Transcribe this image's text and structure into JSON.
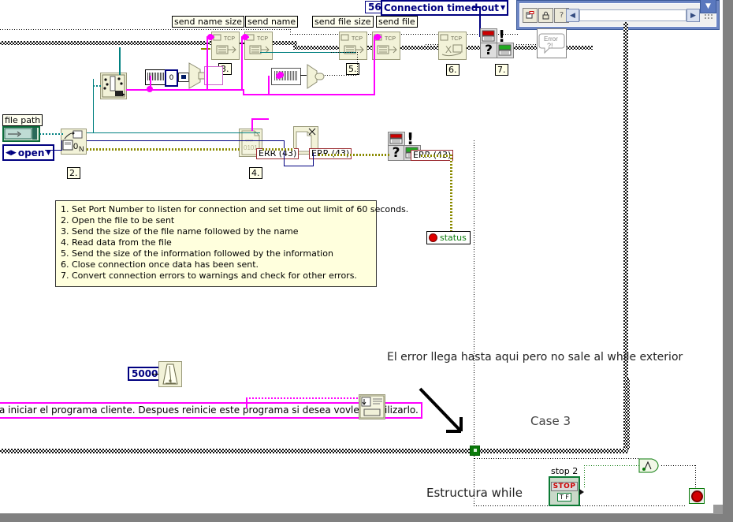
{
  "window": {
    "toolbar_buttons": [
      "diagram-icon",
      "lock-icon",
      "help-icon"
    ],
    "scroll_left": "◀",
    "scroll_right": "▶",
    "scroll_down": "▼"
  },
  "constants": {
    "timeout_value": "56",
    "timeout_enum": "Connection timed out",
    "wait_ms": "5000",
    "open_enum": "open"
  },
  "controls": {
    "file_path_label": "file path",
    "stop_label": "stop 2",
    "stop_button_text": "STOP",
    "stop_tf": "T F",
    "status_label": "status"
  },
  "node_labels": {
    "send_name_size": "send name size",
    "send_name": "send name",
    "send_file_size": "send file size",
    "send_file": "send file"
  },
  "step_markers": {
    "s2": "2.",
    "s3": "3.",
    "s4": "4.",
    "s5": "5.",
    "s6": "6.",
    "s7": "7."
  },
  "error_tags": {
    "e1": "ERR (43)",
    "e2": "ERR (43)",
    "e3": "ERR (43)"
  },
  "icons": {
    "tcp": "TCP",
    "error_bubble": "Error ?!",
    "binary": "0101",
    "file_n": "0 N"
  },
  "comment_box": {
    "lines": [
      "1. Set Port Number to listen for connection and set time out limit of 60 seconds.",
      "2. Open the file to be sent",
      "3. Send the size of the file name followed by the name",
      "4. Read data from the file",
      "5. Send the size of the information followed by the information",
      "6. Close connection once data has been sent.",
      "7. Convert connection errors to warnings and check for other errors."
    ],
    "text": "1. Set Port Number to listen for connection and set time out limit of 60 seconds.\n2. Open the file to be sent\n3. Send the size of the file name followed by the name\n4. Read data from the file\n5. Send the size of the information followed by the information\n6. Close connection once data has been sent.\n7. Convert connection errors to warnings and check for other errors."
  },
  "annotations": {
    "error_note": "El error llega hasta aqui pero no sale al while exterior",
    "case_label": "Case 3",
    "while_label": "Estructura while",
    "dialog_string": "a iniciar el programa cliente. Despues reinicie este programa si desea vovler a utilizarlo."
  },
  "colors": {
    "error_wire": "#8a8a00",
    "string_wire": "#ff00ff",
    "path_wire": "#008080",
    "boolean_wire": "#007000",
    "node_fill": "#f2f2d8",
    "comment_fill": "#ffffdd",
    "enum_border": "#000080",
    "err_tag_border": "#9b2b30"
  }
}
